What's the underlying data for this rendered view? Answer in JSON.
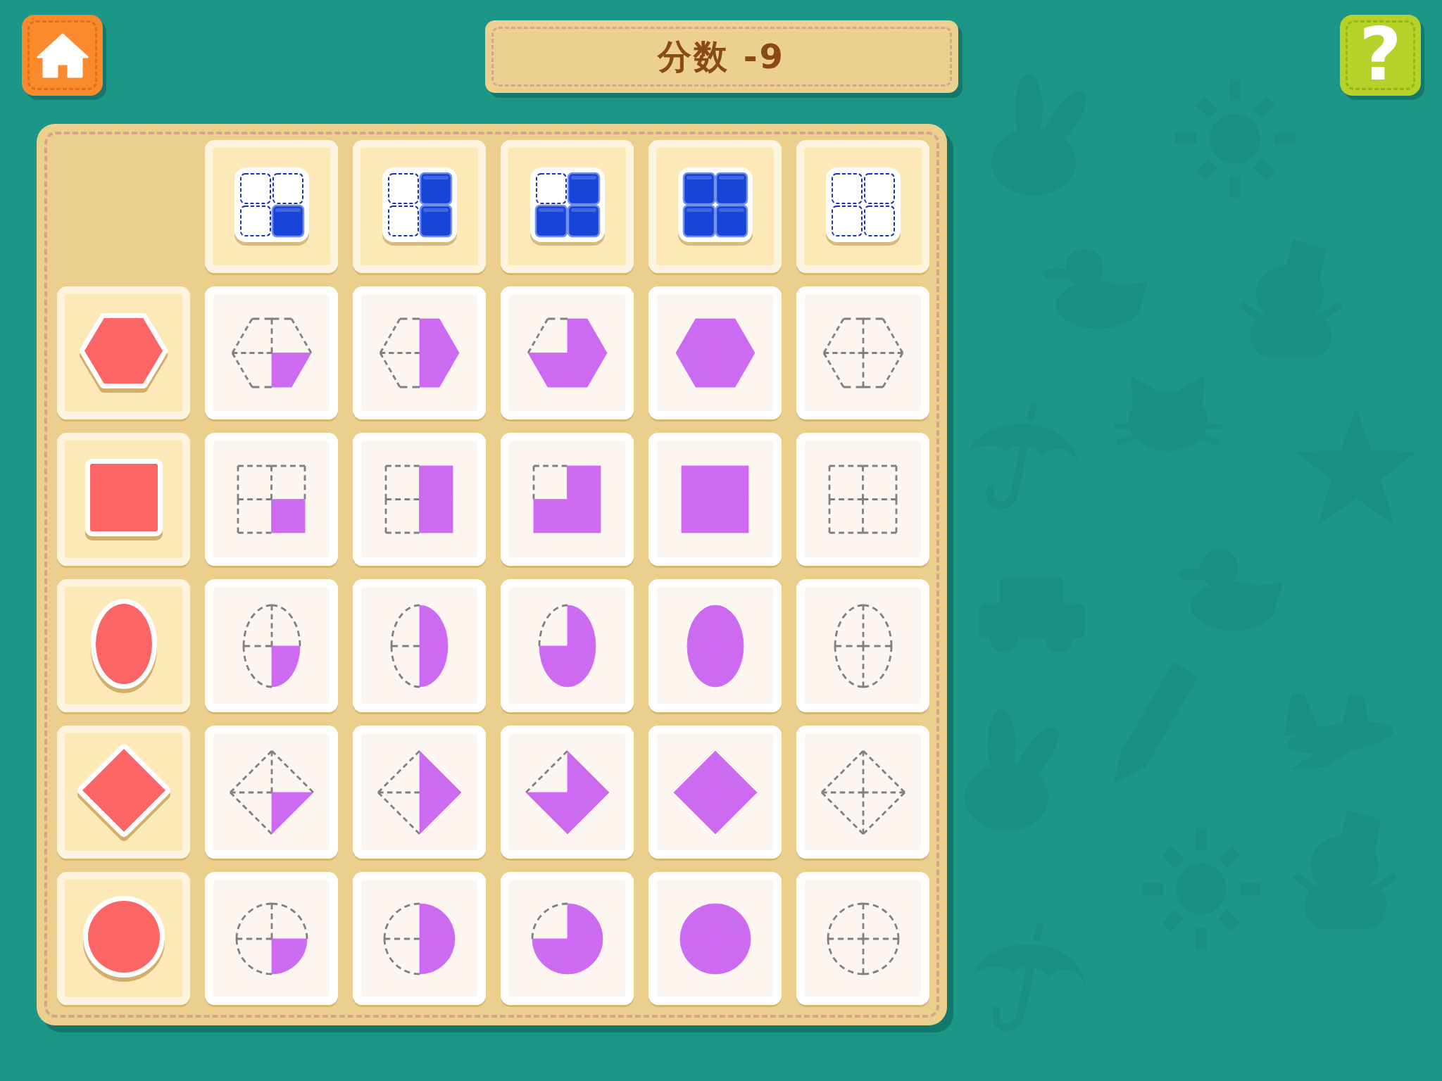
{
  "title": "分数 -9",
  "help_button": {
    "label": "?"
  },
  "board": {
    "columns": [
      {
        "quarters": [
          {
            "filled": false
          },
          {
            "filled": false
          },
          {
            "filled": false
          },
          {
            "filled": true
          }
        ]
      },
      {
        "quarters": [
          {
            "filled": false
          },
          {
            "filled": true
          },
          {
            "filled": false
          },
          {
            "filled": true
          }
        ]
      },
      {
        "quarters": [
          {
            "filled": false
          },
          {
            "filled": true
          },
          {
            "filled": true
          },
          {
            "filled": true
          }
        ]
      },
      {
        "quarters": [
          {
            "filled": true
          },
          {
            "filled": true
          },
          {
            "filled": true
          },
          {
            "filled": true
          }
        ]
      },
      {
        "quarters": [
          {
            "filled": false
          },
          {
            "filled": false
          },
          {
            "filled": false
          },
          {
            "filled": false
          }
        ]
      }
    ],
    "rows": [
      {
        "kind": "hexagon",
        "cells": [
          {
            "quarters": [
              {
                "filled": false
              },
              {
                "filled": false
              },
              {
                "filled": false
              },
              {
                "filled": true
              }
            ]
          },
          {
            "quarters": [
              {
                "filled": false
              },
              {
                "filled": true
              },
              {
                "filled": false
              },
              {
                "filled": true
              }
            ]
          },
          {
            "quarters": [
              {
                "filled": false
              },
              {
                "filled": true
              },
              {
                "filled": true
              },
              {
                "filled": true
              }
            ]
          },
          {
            "quarters": [
              {
                "filled": true
              },
              {
                "filled": true
              },
              {
                "filled": true
              },
              {
                "filled": true
              }
            ]
          },
          {
            "quarters": [
              {
                "filled": false
              },
              {
                "filled": false
              },
              {
                "filled": false
              },
              {
                "filled": false
              }
            ]
          }
        ]
      },
      {
        "kind": "square",
        "cells": [
          {
            "quarters": [
              {
                "filled": false
              },
              {
                "filled": false
              },
              {
                "filled": false
              },
              {
                "filled": true
              }
            ]
          },
          {
            "quarters": [
              {
                "filled": false
              },
              {
                "filled": true
              },
              {
                "filled": false
              },
              {
                "filled": true
              }
            ]
          },
          {
            "quarters": [
              {
                "filled": false
              },
              {
                "filled": true
              },
              {
                "filled": true
              },
              {
                "filled": true
              }
            ]
          },
          {
            "quarters": [
              {
                "filled": true
              },
              {
                "filled": true
              },
              {
                "filled": true
              },
              {
                "filled": true
              }
            ]
          },
          {
            "quarters": [
              {
                "filled": false
              },
              {
                "filled": false
              },
              {
                "filled": false
              },
              {
                "filled": false
              }
            ]
          }
        ]
      },
      {
        "kind": "ellipse",
        "cells": [
          {
            "quarters": [
              {
                "filled": false
              },
              {
                "filled": false
              },
              {
                "filled": false
              },
              {
                "filled": true
              }
            ]
          },
          {
            "quarters": [
              {
                "filled": false
              },
              {
                "filled": true
              },
              {
                "filled": false
              },
              {
                "filled": true
              }
            ]
          },
          {
            "quarters": [
              {
                "filled": false
              },
              {
                "filled": true
              },
              {
                "filled": true
              },
              {
                "filled": true
              }
            ]
          },
          {
            "quarters": [
              {
                "filled": true
              },
              {
                "filled": true
              },
              {
                "filled": true
              },
              {
                "filled": true
              }
            ]
          },
          {
            "quarters": [
              {
                "filled": false
              },
              {
                "filled": false
              },
              {
                "filled": false
              },
              {
                "filled": false
              }
            ]
          }
        ]
      },
      {
        "kind": "diamond",
        "cells": [
          {
            "quarters": [
              {
                "filled": false
              },
              {
                "filled": false
              },
              {
                "filled": false
              },
              {
                "filled": true
              }
            ]
          },
          {
            "quarters": [
              {
                "filled": false
              },
              {
                "filled": true
              },
              {
                "filled": false
              },
              {
                "filled": true
              }
            ]
          },
          {
            "quarters": [
              {
                "filled": false
              },
              {
                "filled": true
              },
              {
                "filled": true
              },
              {
                "filled": true
              }
            ]
          },
          {
            "quarters": [
              {
                "filled": true
              },
              {
                "filled": true
              },
              {
                "filled": true
              },
              {
                "filled": true
              }
            ]
          },
          {
            "quarters": [
              {
                "filled": false
              },
              {
                "filled": false
              },
              {
                "filled": false
              },
              {
                "filled": false
              }
            ]
          }
        ]
      },
      {
        "kind": "circle",
        "cells": [
          {
            "quarters": [
              {
                "filled": false
              },
              {
                "filled": false
              },
              {
                "filled": false
              },
              {
                "filled": true
              }
            ]
          },
          {
            "quarters": [
              {
                "filled": false
              },
              {
                "filled": true
              },
              {
                "filled": false
              },
              {
                "filled": true
              }
            ]
          },
          {
            "quarters": [
              {
                "filled": false
              },
              {
                "filled": true
              },
              {
                "filled": true
              },
              {
                "filled": true
              }
            ]
          },
          {
            "quarters": [
              {
                "filled": true
              },
              {
                "filled": true
              },
              {
                "filled": true
              },
              {
                "filled": true
              }
            ]
          },
          {
            "quarters": [
              {
                "filled": false
              },
              {
                "filled": false
              },
              {
                "filled": false
              },
              {
                "filled": false
              }
            ]
          }
        ]
      }
    ]
  }
}
